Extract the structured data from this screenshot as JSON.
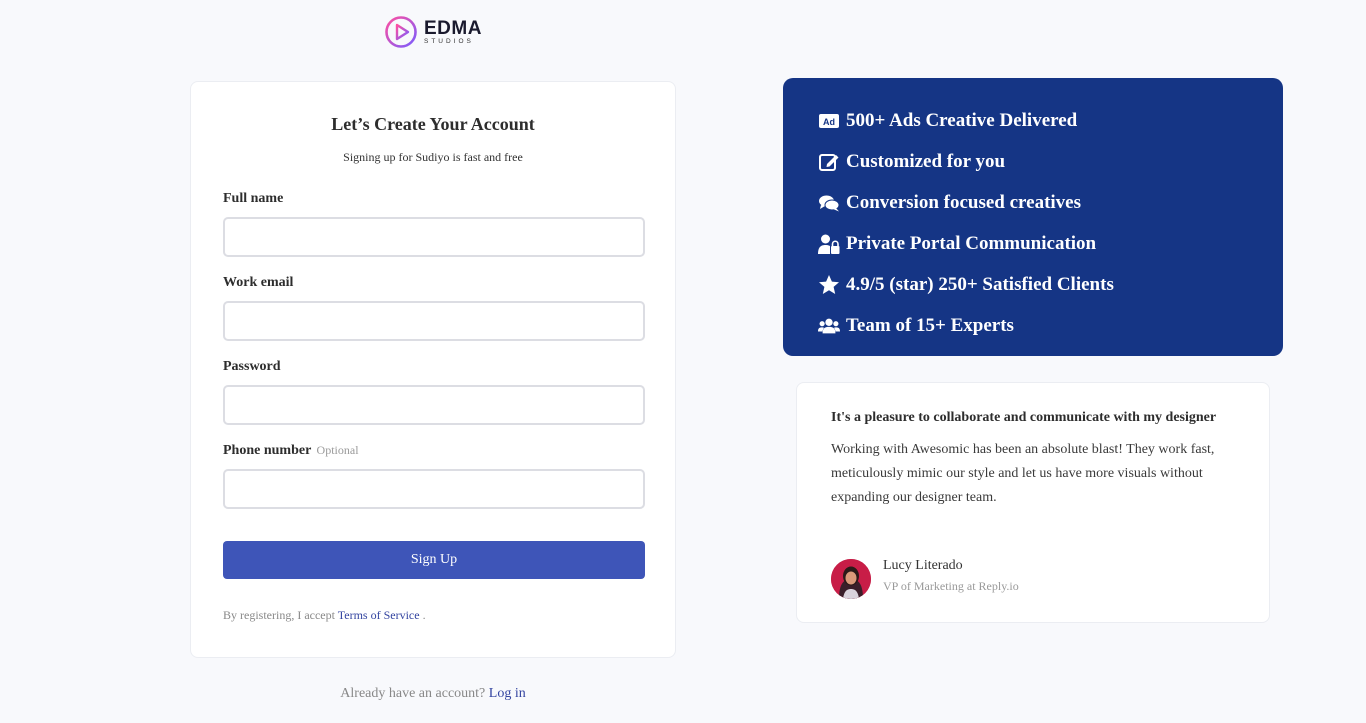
{
  "logo": {
    "word": "EDMA",
    "sub": "STUDIOS"
  },
  "form": {
    "title": "Let’s Create Your Account",
    "subtitle": "Signing up for Sudiyo is fast and free",
    "fields": [
      {
        "label": "Full name",
        "value": "",
        "placeholder": ""
      },
      {
        "label": "Work email",
        "value": "",
        "placeholder": ""
      },
      {
        "label": "Password",
        "value": "",
        "placeholder": ""
      },
      {
        "label": "Phone number",
        "optional": "Optional",
        "value": "",
        "placeholder": ""
      }
    ],
    "submit_label": "Sign Up",
    "terms_prefix": "By registering, I accept",
    "terms_link": "Terms of Service",
    "terms_suffix": "."
  },
  "login": {
    "prompt": "Already have an account?",
    "link": "Log in"
  },
  "features": [
    {
      "icon": "ad-icon",
      "text": "500+ Ads Creative Delivered"
    },
    {
      "icon": "edit-icon",
      "text": "Customized for you"
    },
    {
      "icon": "comments-icon",
      "text": "Conversion focused creatives"
    },
    {
      "icon": "user-lock-icon",
      "text": "Private Portal Communication"
    },
    {
      "icon": "star-icon",
      "text": "4.9/5 (star) 250+ Satisfied Clients"
    },
    {
      "icon": "users-icon",
      "text": "Team of 15+ Experts"
    }
  ],
  "testimonial": {
    "heading": "It's a pleasure to collaborate and communicate with my designer",
    "body": "Working with Awesomic has been an absolute blast! They work fast, meticulously mimic our style and let us have more visuals without expanding our designer team.",
    "author_name": "Lucy Literado",
    "author_role": "VP of Marketing at Reply.io"
  },
  "colors": {
    "primary_button": "#3e55b8",
    "features_bg": "#153585",
    "link": "#3344a0",
    "page_bg": "#f8f9fc"
  }
}
